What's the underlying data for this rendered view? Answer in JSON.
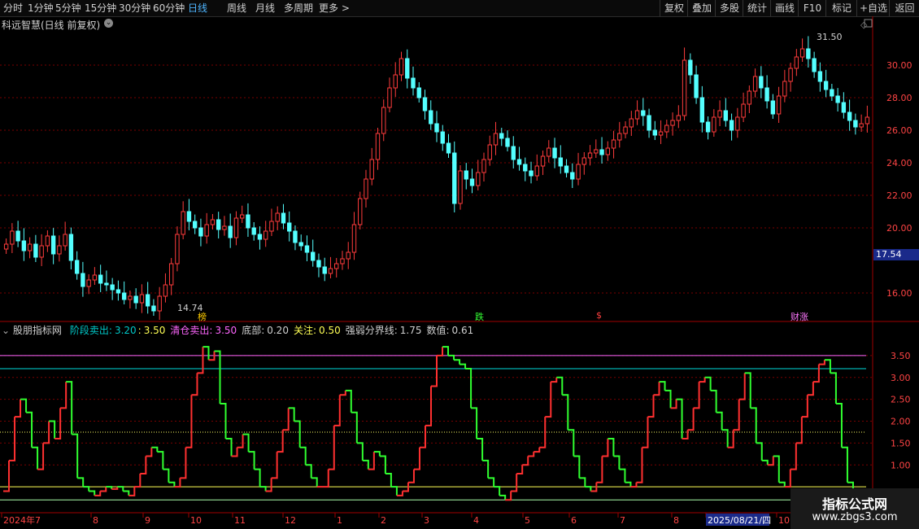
{
  "toolbar": {
    "periods": [
      "分时",
      "1分钟",
      "5分钟",
      "15分钟",
      "30分钟",
      "60分钟",
      "日线",
      "周线",
      "月线",
      "多周期",
      "更多 >"
    ],
    "active_period": "日线",
    "right_buttons": [
      "复权",
      "叠加",
      "多股",
      "统计",
      "画线",
      "F10",
      "标记",
      "+自选",
      "返回"
    ]
  },
  "stock": {
    "title": "科远智慧(日线 前复权)",
    "price_marker": "17.54",
    "high_label": "31.50",
    "low_label": "14.74"
  },
  "event_marks": [
    "榜",
    "跌",
    "$",
    "财涨"
  ],
  "indicator": {
    "name": "股朋指标网",
    "items": [
      {
        "label": "阶段卖出:",
        "value": "3.20",
        "color": "#00c8c8"
      },
      {
        "label": ":",
        "value": "3.50",
        "color": "#ffff55"
      },
      {
        "label": "清仓卖出:",
        "value": "3.50",
        "color": "#ff66ff"
      },
      {
        "label": "底部:",
        "value": "0.20",
        "color": "#d0d0d0"
      },
      {
        "label": "关注:",
        "value": "0.50",
        "color": "#ffff55"
      },
      {
        "label": "强弱分界线:",
        "value": "1.75",
        "color": "#d0d0d0"
      },
      {
        "label": "数值:",
        "value": "0.61",
        "color": "#d0d0d0"
      }
    ]
  },
  "price_axis": {
    "ticks": [
      "30.00",
      "28.00",
      "26.00",
      "24.00",
      "22.00",
      "20.00",
      "16.00"
    ]
  },
  "indicator_axis": {
    "ticks": [
      "3.50",
      "3.00",
      "2.50",
      "2.00",
      "1.50",
      "1.00"
    ]
  },
  "time_axis": {
    "labels": [
      "2024年7",
      "8",
      "9",
      "10",
      "11",
      "12",
      "1",
      "2",
      "3",
      "4",
      "5",
      "6",
      "7",
      "8",
      "2025/08/21/四",
      "10"
    ]
  },
  "colors": {
    "up": "#ff3c3c",
    "down": "#54ffff",
    "ind_up": "#ff3030",
    "ind_down": "#30ff30",
    "grid": "#7a0000"
  },
  "watermark": {
    "line1": "指标公式网",
    "line2": "www.zbgs3.com"
  },
  "chart_data": {
    "type": "candlestick",
    "price_ylim": [
      15,
      32
    ],
    "indicator_ylim": [
      0,
      4
    ],
    "close_series": [
      19,
      19.8,
      19.2,
      18.6,
      19.0,
      18.2,
      18.9,
      19.5,
      18.4,
      18.9,
      19.6,
      18.0,
      17.2,
      16.4,
      16.8,
      17.1,
      16.6,
      16.5,
      16.2,
      16.0,
      15.6,
      15.8,
      15.4,
      15.9,
      15.2,
      14.9,
      15.8,
      16.5,
      17.8,
      19.6,
      21.0,
      20.4,
      20.0,
      19.5,
      20.2,
      20.5,
      19.9,
      20.1,
      19.4,
      20.6,
      20.8,
      20.0,
      19.6,
      19.3,
      19.8,
      20.4,
      20.9,
      20.3,
      19.8,
      19.1,
      18.9,
      18.5,
      18.0,
      17.6,
      17.2,
      17.5,
      17.8,
      18.1,
      18.5,
      20.2,
      21.8,
      23.0,
      24.2,
      25.8,
      27.4,
      28.6,
      29.4,
      30.4,
      29.2,
      28.6,
      28.0,
      27.2,
      26.4,
      25.9,
      25.2,
      24.6,
      21.5,
      23.5,
      23.0,
      22.6,
      23.4,
      24.2,
      25.1,
      25.8,
      25.5,
      25.0,
      24.2,
      23.9,
      23.5,
      23.2,
      23.8,
      24.4,
      24.9,
      24.3,
      23.8,
      23.4,
      23.0,
      23.9,
      24.3,
      24.6,
      24.8,
      24.5,
      24.9,
      25.4,
      25.8,
      26.2,
      26.7,
      27.2,
      26.9,
      26.0,
      25.7,
      25.9,
      26.3,
      26.6,
      26.9,
      30.3,
      29.4,
      28.0,
      26.5,
      25.9,
      26.8,
      27.2,
      26.6,
      26.0,
      26.8,
      27.6,
      28.4,
      29.3,
      28.6,
      27.8,
      27.0,
      28.1,
      29.0,
      29.8,
      30.5,
      31.0,
      30.4,
      29.6,
      29.0,
      28.5,
      28.1,
      27.7,
      27.1,
      26.6,
      26.2,
      26.4,
      26.8
    ],
    "indicator_series": [
      0.4,
      1.1,
      2.1,
      2.5,
      2.2,
      1.4,
      0.9,
      1.5,
      2.0,
      1.6,
      2.3,
      2.9,
      1.7,
      0.7,
      0.5,
      0.4,
      0.3,
      0.4,
      0.5,
      0.45,
      0.5,
      0.4,
      0.3,
      0.5,
      0.8,
      1.2,
      1.4,
      1.3,
      0.9,
      0.6,
      0.5,
      0.7,
      1.4,
      2.6,
      3.1,
      3.7,
      3.4,
      3.6,
      2.4,
      1.6,
      1.2,
      1.4,
      1.7,
      1.3,
      0.9,
      0.5,
      0.4,
      0.7,
      1.3,
      1.8,
      2.3,
      2.0,
      1.4,
      1.0,
      0.7,
      0.5,
      0.5,
      0.9,
      1.9,
      2.6,
      2.7,
      2.2,
      1.5,
      1.1,
      0.9,
      1.3,
      1.2,
      0.8,
      0.5,
      0.3,
      0.4,
      0.6,
      0.9,
      1.4,
      1.9,
      2.8,
      3.5,
      3.7,
      3.5,
      3.4,
      3.3,
      3.2,
      2.3,
      1.6,
      1.1,
      0.7,
      0.5,
      0.3,
      0.2,
      0.4,
      0.8,
      1.0,
      1.2,
      1.3,
      1.4,
      2.1,
      2.9,
      3.0,
      2.6,
      1.8,
      1.2,
      0.7,
      0.5,
      0.4,
      0.6,
      1.2,
      1.6,
      1.2,
      0.9,
      0.6,
      0.5,
      0.6,
      1.4,
      2.1,
      2.6,
      2.9,
      2.7,
      2.3,
      2.5,
      1.6,
      1.8,
      2.3,
      2.9,
      3.0,
      2.7,
      2.2,
      1.8,
      1.4,
      1.8,
      2.5,
      3.1,
      2.3,
      1.5,
      1.1,
      1.0,
      1.2,
      0.6,
      0.5,
      0.9,
      1.5,
      2.1,
      2.6,
      2.9,
      3.3,
      3.4,
      3.1,
      2.4,
      1.4,
      0.6,
      0.3,
      0.25,
      0.3
    ]
  }
}
